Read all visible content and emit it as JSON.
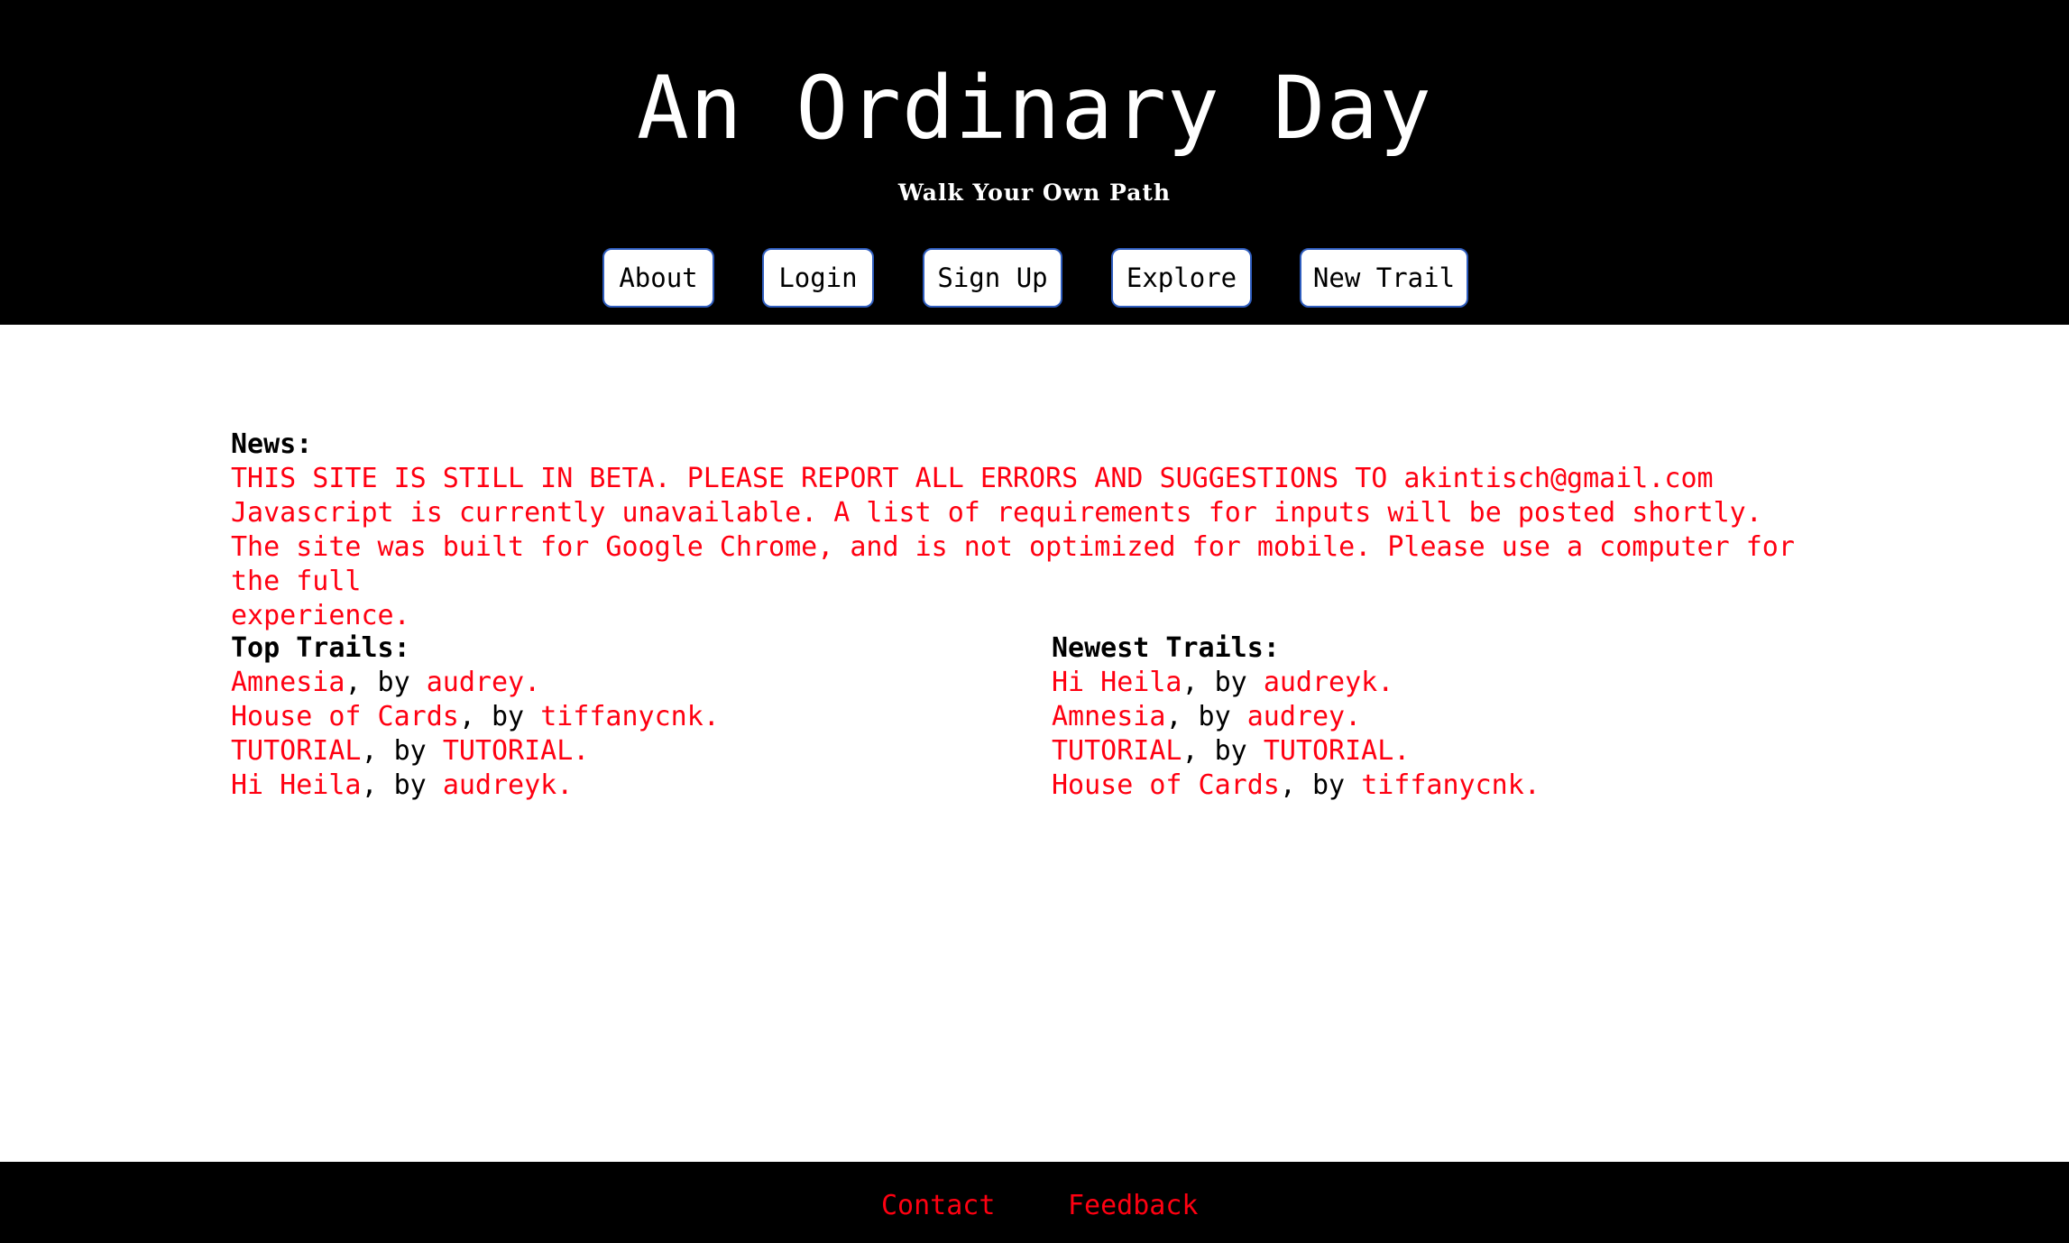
{
  "header": {
    "title": "An Ordinary Day",
    "tagline": "Walk Your Own Path"
  },
  "nav": {
    "about": "About",
    "login": "Login",
    "signup": "Sign Up",
    "explore": "Explore",
    "new_trail": "New Trail"
  },
  "news": {
    "heading": "News:",
    "lines": [
      "THIS SITE IS STILL IN BETA. PLEASE REPORT ALL ERRORS AND SUGGESTIONS TO akintisch@gmail.com",
      "Javascript is currently unavailable. A list of requirements for inputs will be posted shortly.",
      "The site was built for Google Chrome, and is not optimized for mobile. Please use a computer for the full",
      "experience."
    ]
  },
  "top_trails": {
    "heading": "Top Trails:",
    "items": [
      {
        "title": "Amnesia",
        "sep": ", by ",
        "author": "audrey."
      },
      {
        "title": "House of Cards",
        "sep": ", by ",
        "author": "tiffanycnk."
      },
      {
        "title": "TUTORIAL",
        "sep": ", by ",
        "author": "TUTORIAL."
      },
      {
        "title": "Hi Heila",
        "sep": ", by ",
        "author": "audreyk."
      }
    ]
  },
  "newest_trails": {
    "heading": "Newest Trails:",
    "items": [
      {
        "title": "Hi Heila",
        "sep": ", by ",
        "author": "audreyk."
      },
      {
        "title": "Amnesia",
        "sep": ", by ",
        "author": "audrey."
      },
      {
        "title": "TUTORIAL",
        "sep": ", by ",
        "author": "TUTORIAL."
      },
      {
        "title": "House of Cards",
        "sep": ", by ",
        "author": "tiffanycnk."
      }
    ]
  },
  "footer": {
    "contact": "Contact",
    "feedback": "Feedback"
  },
  "colors": {
    "header_bg": "#000000",
    "accent": "#ff0011",
    "button_border": "#2f5dbe"
  }
}
